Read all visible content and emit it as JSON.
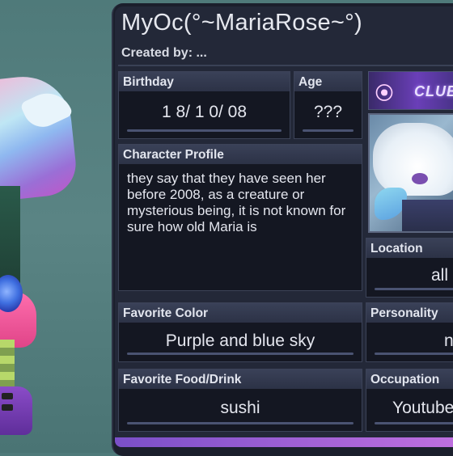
{
  "title": "MyOc(°~MariaRose~°)",
  "created_by": "Created by: ...",
  "banner": {
    "text": "CLUB"
  },
  "fields": {
    "birthday": {
      "label": "Birthday",
      "value": "1 8/ 1 0/ 08"
    },
    "age": {
      "label": "Age",
      "value": "???"
    },
    "character_profile": {
      "label": "Character Profile",
      "value": "they say that they have seen her before 2008, as a creature or mysterious being, it is not known for sure how old Maria is"
    },
    "location": {
      "label": "Location",
      "value": "all"
    },
    "favorite_color": {
      "label": "Favorite Color",
      "value": "Purple and blue sky"
    },
    "personality": {
      "label": "Personality",
      "value": "n"
    },
    "favorite_food": {
      "label": "Favorite Food/Drink",
      "value": "sushi"
    },
    "occupation": {
      "label": "Occupation",
      "value": "Youtube"
    }
  },
  "colors": {
    "background": "#5a8484",
    "card": "#1b1f2c",
    "field_bg": "#141722",
    "label_bg": "#3a4158",
    "accent": "#7a4fc8"
  }
}
